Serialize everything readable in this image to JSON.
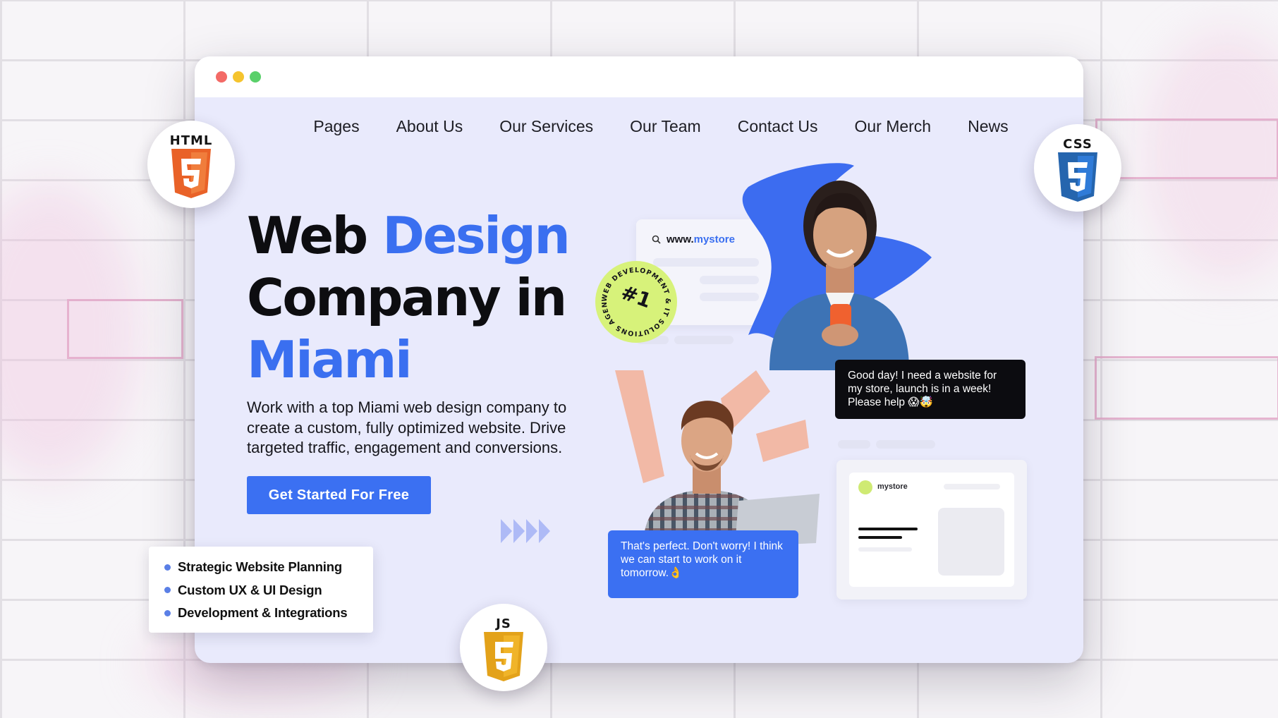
{
  "nav": {
    "items": [
      "Pages",
      "About Us",
      "Our Services",
      "Our Team",
      "Contact Us",
      "Our Merch",
      "News"
    ]
  },
  "hero": {
    "title_line1_a": "Web ",
    "title_line1_b": "Design",
    "title_line2": "Company in",
    "title_line3": "Miami",
    "description": "Work with a top Miami web design company to create a custom, fully optimized website. Drive targeted traffic, engagement and conversions.",
    "cta_label": "Get Started For Free"
  },
  "illustration": {
    "search_prefix": "www.",
    "search_highlight": "mystore",
    "badge_number": "#1",
    "badge_ring_text": "WEB DEVELOPMENT & IT SOLUTIONS AGENCY",
    "chat_customer": "Good day! I need a website for my store, launch is in a week! Please help 😱🤯",
    "chat_agent": "That's perfect. Don't worry! I think we can start to work on it tomorrow.👌",
    "store_name": "mystore"
  },
  "features": {
    "items": [
      "Strategic Website Planning",
      "Custom UX & UI Design",
      "Development & Integrations"
    ]
  },
  "tech_badges": {
    "html": "HTML",
    "css": "CSS",
    "js": "JS"
  },
  "colors": {
    "accent": "#3b70f2",
    "page_bg": "#e9eafc",
    "html_orange": "#e96228",
    "css_blue": "#2f7bd8",
    "js_yellow": "#f0b429",
    "badge_lime": "#d7f27a"
  }
}
